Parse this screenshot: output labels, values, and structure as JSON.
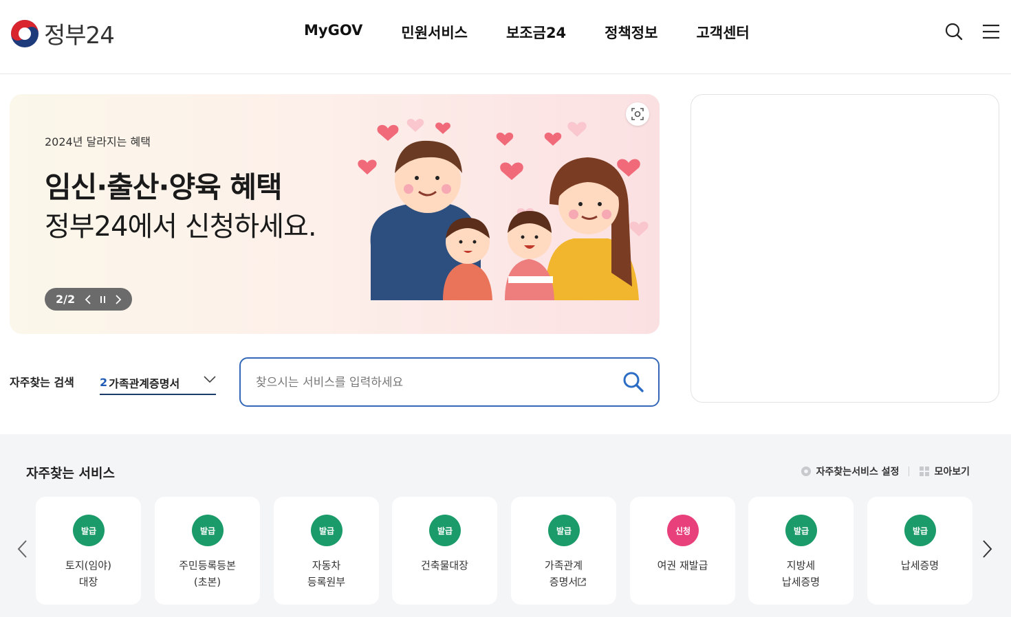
{
  "header": {
    "logo_text": "정부24",
    "nav": [
      "MyGOV",
      "민원서비스",
      "보조금24",
      "정책정보",
      "고객센터"
    ]
  },
  "banner": {
    "eyebrow": "2024년 달라지는 혜택",
    "headline": "임신·출산·양육 혜택",
    "subheadline": "정부24에서 신청하세요.",
    "slide_counter": "2/2"
  },
  "search": {
    "fav_label": "자주찾는 검색",
    "fav_rank": "2",
    "fav_term": "가족관계증명서",
    "placeholder": "찾으시는 서비스를 입력하세요"
  },
  "services": {
    "title": "자주찾는 서비스",
    "settings_label": "자주찾는서비스 설정",
    "collect_label": "모아보기",
    "items": [
      {
        "badge": "발급",
        "badge_color": "#1c9b6a",
        "label": "토지(임야)\n대장"
      },
      {
        "badge": "발급",
        "badge_color": "#1c9b6a",
        "label": "주민등록등본\n(초본)"
      },
      {
        "badge": "발급",
        "badge_color": "#1c9b6a",
        "label": "자동차\n등록원부"
      },
      {
        "badge": "발급",
        "badge_color": "#1c9b6a",
        "label": "건축물대장"
      },
      {
        "badge": "발급",
        "badge_color": "#1c9b6a",
        "label": "가족관계\n증명서"
      },
      {
        "badge": "신청",
        "badge_color": "#e8407b",
        "label": "여권 재발급"
      },
      {
        "badge": "발급",
        "badge_color": "#1c9b6a",
        "label": "지방세\n납세증명"
      },
      {
        "badge": "발급",
        "badge_color": "#1c9b6a",
        "label": "납세증명"
      }
    ]
  },
  "colors": {
    "accent": "#3467b8",
    "badge_issue": "#1c9b6a",
    "badge_apply": "#e8407b"
  }
}
